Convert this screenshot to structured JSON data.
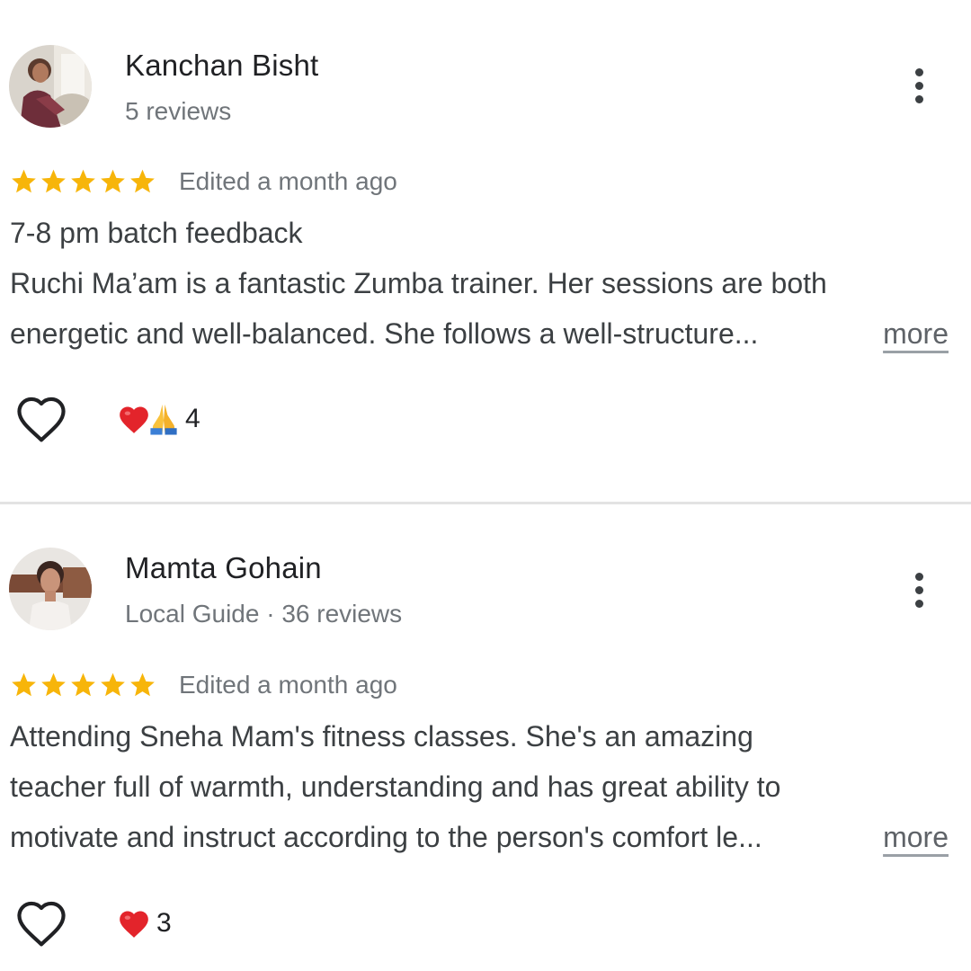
{
  "reviews": [
    {
      "reviewer_name": "Kanchan Bisht",
      "reviewer_meta": "5 reviews",
      "rating_stars": 5,
      "date": "Edited a month ago",
      "text_lines": [
        "7-8 pm batch feedback",
        "Ruchi Ma’am is a fantastic Zumba trainer. Her sessions are both",
        "energetic and well-balanced. She follows a well-structure..."
      ],
      "more_label": "more",
      "reactions": [
        "heart-emoji",
        "folded-hands-emoji"
      ],
      "reaction_count": "4"
    },
    {
      "reviewer_name": "Mamta Gohain",
      "reviewer_meta": "Local Guide · 36 reviews",
      "rating_stars": 5,
      "date": "Edited a month ago",
      "text_lines": [
        "Attending Sneha Mam's fitness classes. She's an amazing",
        "teacher full of warmth, understanding and has great ability to",
        "motivate and instruct according to the person's comfort le..."
      ],
      "more_label": "more",
      "reactions": [
        "heart-emoji"
      ],
      "reaction_count": "3"
    }
  ],
  "colors": {
    "star": "#f7b50a",
    "heart": "#e3242b",
    "secondary_text": "#70757a",
    "divider": "#e3e3e3"
  }
}
